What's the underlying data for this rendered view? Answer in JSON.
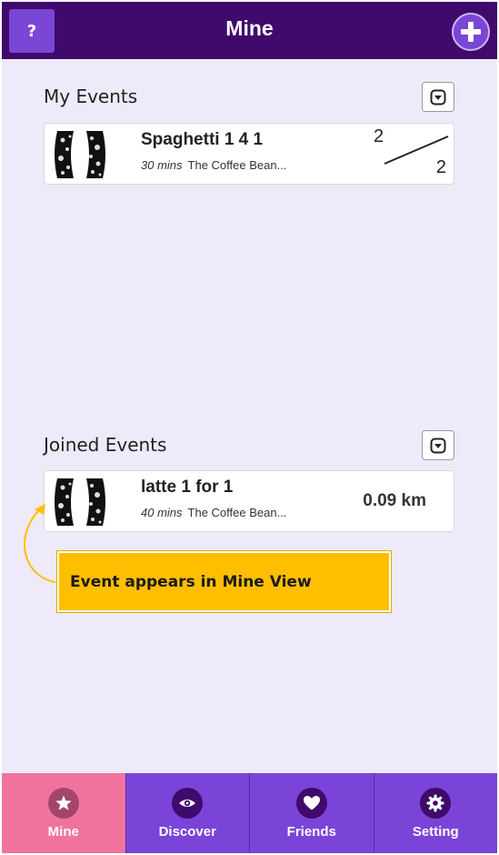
{
  "header": {
    "title": "Mine",
    "help_label": "?"
  },
  "my_events": {
    "title": "My Events",
    "items": [
      {
        "name": "Spaghetti 1 4 1",
        "duration": "30 mins",
        "location": "The Coffee Bean...",
        "slots_taken": "2",
        "slots_total": "2"
      }
    ]
  },
  "joined_events": {
    "title": "Joined Events",
    "items": [
      {
        "name": "latte 1 for 1",
        "duration": "40 mins",
        "location": "The Coffee Bean...",
        "distance": "0.09 km"
      }
    ]
  },
  "annotation": {
    "text": "Event appears in Mine View"
  },
  "nav": {
    "items": [
      {
        "label": "Mine",
        "icon": "star-icon",
        "active": true
      },
      {
        "label": "Discover",
        "icon": "eye-icon",
        "active": false
      },
      {
        "label": "Friends",
        "icon": "heart-icon",
        "active": false
      },
      {
        "label": "Setting",
        "icon": "gear-icon",
        "active": false
      }
    ]
  },
  "colors": {
    "header_bg": "#3f0a6b",
    "accent": "#7a46d6",
    "nav_bg": "#7a44d8",
    "nav_active": "#f0739e",
    "background": "#eeeafa",
    "callout": "#ffbf00"
  }
}
